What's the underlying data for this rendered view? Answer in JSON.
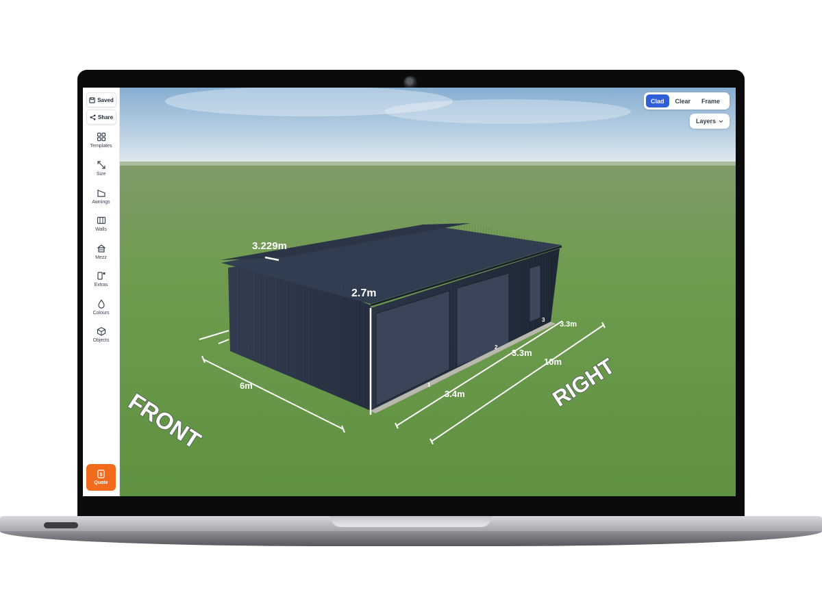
{
  "sidebar": {
    "saved_label": "Saved",
    "share_label": "Share",
    "items": [
      {
        "label": "Templates",
        "icon": "grid-icon"
      },
      {
        "label": "Size",
        "icon": "resize-arrows-icon"
      },
      {
        "label": "Awnings",
        "icon": "awning-icon"
      },
      {
        "label": "Walls",
        "icon": "walls-icon"
      },
      {
        "label": "Mezz",
        "icon": "house-icon"
      },
      {
        "label": "Extras",
        "icon": "extras-icon"
      },
      {
        "label": "Colours",
        "icon": "droplet-icon"
      },
      {
        "label": "Objects",
        "icon": "cube-icon"
      }
    ],
    "quote_label": "Quote"
  },
  "view_modes": {
    "options": [
      "Clad",
      "Clear",
      "Frame"
    ],
    "selected": "Clad"
  },
  "layers_label": "Layers",
  "scene": {
    "dimensions": {
      "roof_width": "3.229m",
      "wall_height": "2.7m",
      "front_width": "6m",
      "length": "10m",
      "bay_1": "3.4m",
      "bay_2": "3.3m",
      "bay_3": "3.3m"
    },
    "bay_numbers": [
      "1",
      "2",
      "3"
    ],
    "front_label": "FRONT",
    "right_label": "RIGHT",
    "shed_color": "#2e3848",
    "accent_color": "#2f5fd8",
    "quote_color": "#f26b1d"
  }
}
